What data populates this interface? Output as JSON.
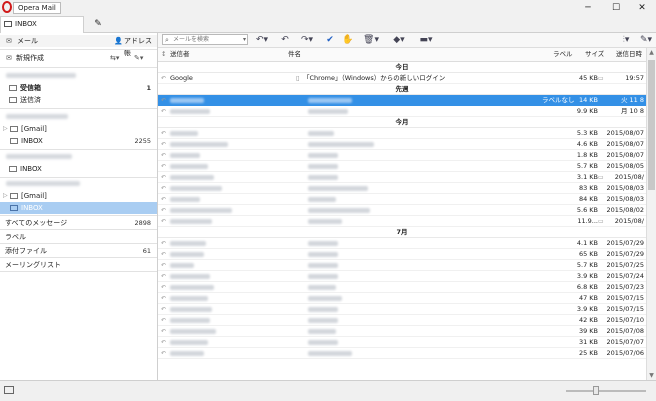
{
  "window": {
    "app_name": "Opera Mail",
    "minimize": "─",
    "maximize": "☐",
    "close": "✕"
  },
  "tabs": {
    "inbox_label": "INBOX",
    "compose_icon": "✎"
  },
  "sidebar": {
    "mail_label": "メール",
    "address_book_label": "アドレス帳",
    "new_mail_label": "新規作成",
    "account1": {
      "inbox": "受信箱",
      "inbox_count": "1",
      "sent": "送信済"
    },
    "gmail1": {
      "folder": "[Gmail]",
      "inbox": "INBOX",
      "inbox_count": "2255"
    },
    "account3": {
      "inbox": "INBOX"
    },
    "gmail2": {
      "folder": "[Gmail]",
      "inbox": "INBOX"
    },
    "views": [
      {
        "label": "すべてのメッセージ",
        "count": "2898"
      },
      {
        "label": "ラベル",
        "count": ""
      },
      {
        "label": "添付ファイル",
        "count": "61"
      },
      {
        "label": "メーリングリスト",
        "count": ""
      }
    ]
  },
  "toolbar": {
    "search_placeholder": "メールを検索",
    "icons": [
      "reply-icon",
      "reply-all-icon",
      "forward-icon",
      "mark-read-icon",
      "spam-icon",
      "delete-icon",
      "label-icon",
      "move-icon"
    ]
  },
  "columns": {
    "from": "送信者",
    "subject": "件名",
    "label": "ラベル",
    "size": "サイズ",
    "date": "送信日時"
  },
  "sections": {
    "today": "今日",
    "last_week": "先週",
    "this_month": "今月",
    "july": "7月"
  },
  "messages_today": [
    {
      "from": "Google",
      "subject": "「Chrome」（Windows）からの新しいログイン",
      "size": "45 KB",
      "date": "19:57",
      "clip": "▭"
    }
  ],
  "messages_last_week": [
    {
      "label": "ラベルなし",
      "size": "14 KB",
      "date": "火 11 8",
      "selected": true
    },
    {
      "size": "9.9 KB",
      "date": "月 10 8"
    }
  ],
  "messages_this_month": [
    {
      "size": "5.3 KB",
      "date": "2015/08/07"
    },
    {
      "size": "4.6 KB",
      "date": "2015/08/07"
    },
    {
      "size": "1.8 KB",
      "date": "2015/08/07"
    },
    {
      "size": "5.7 KB",
      "date": "2015/08/05"
    },
    {
      "size": "3.1 KB",
      "date": "2015/08/",
      "clip": "▭"
    },
    {
      "size": "83 KB",
      "date": "2015/08/03"
    },
    {
      "size": "84 KB",
      "date": "2015/08/03"
    },
    {
      "size": "5.6 KB",
      "date": "2015/08/02"
    },
    {
      "size": "11.9...",
      "date": "2015/08/",
      "clip": "▭"
    }
  ],
  "messages_july": [
    {
      "size": "4.1 KB",
      "date": "2015/07/29"
    },
    {
      "size": "65 KB",
      "date": "2015/07/29"
    },
    {
      "size": "5.7 KB",
      "date": "2015/07/25"
    },
    {
      "size": "3.9 KB",
      "date": "2015/07/24"
    },
    {
      "size": "6.8 KB",
      "date": "2015/07/23"
    },
    {
      "size": "47 KB",
      "date": "2015/07/15"
    },
    {
      "size": "3.9 KB",
      "date": "2015/07/15"
    },
    {
      "size": "42 KB",
      "date": "2015/07/10"
    },
    {
      "size": "39 KB",
      "date": "2015/07/08"
    },
    {
      "size": "31 KB",
      "date": "2015/07/07"
    },
    {
      "size": "25 KB",
      "date": "2015/07/06"
    }
  ]
}
